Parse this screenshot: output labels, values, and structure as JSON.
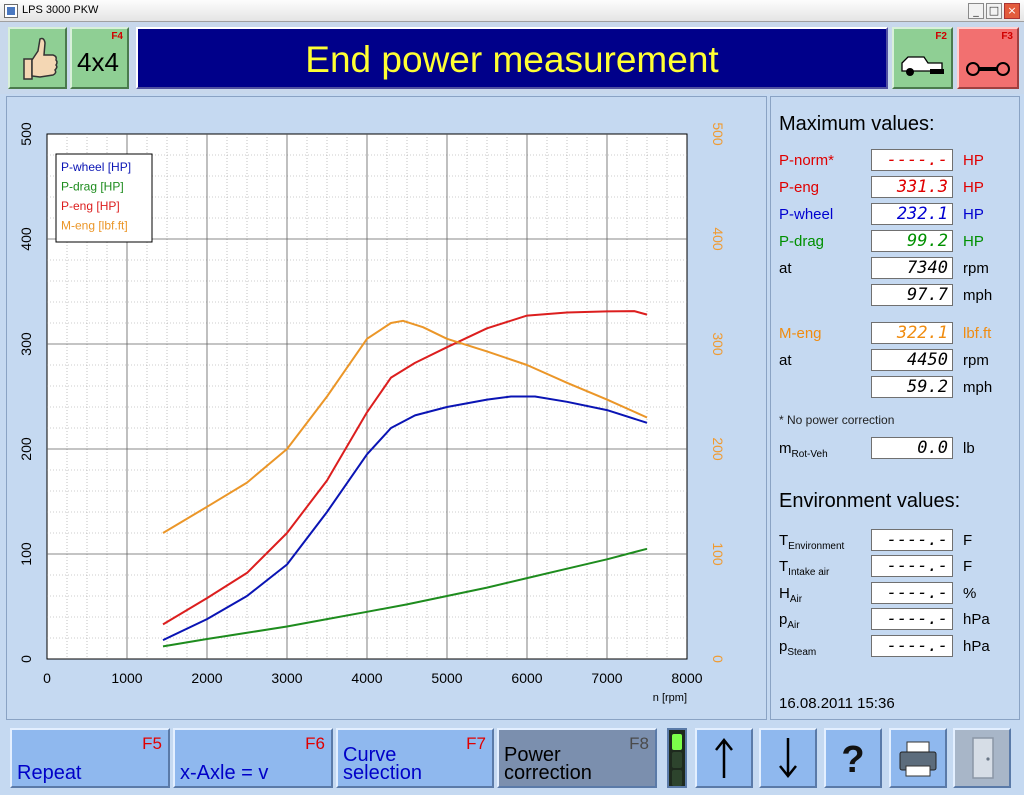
{
  "window": {
    "title": "LPS 3000 PKW",
    "min": "_",
    "max": "□",
    "close": "×"
  },
  "toolbar": {
    "ok_icon": "thumbs-up-icon",
    "fourbyfour_label": "4x4",
    "fourbyfour_fkey": "F4",
    "page_title": "End power measurement",
    "f2_fkey": "F2",
    "f2_icon": "dyno-vehicle-icon",
    "f3_fkey": "F3",
    "f3_icon": "dyno-rollers-icon"
  },
  "chart_data": {
    "type": "line",
    "xlabel": "n [rpm]",
    "xlim": [
      0,
      8000
    ],
    "ylim_left": [
      0,
      500
    ],
    "ylim_right": [
      0,
      500
    ],
    "x_ticks": [
      "0",
      "1000",
      "2000",
      "3000",
      "4000",
      "5000",
      "6000",
      "7000",
      "8000"
    ],
    "y_ticks": [
      "0",
      "100",
      "200",
      "300",
      "400",
      "500"
    ],
    "grid": true,
    "legend_position": "top-left",
    "series": [
      {
        "name": "P-wheel [HP]",
        "color": "#0a14b4",
        "x": [
          1450,
          2000,
          2500,
          3000,
          3500,
          4000,
          4300,
          4600,
          5000,
          5500,
          5800,
          6100,
          6500,
          7000,
          7500
        ],
        "y": [
          18,
          38,
          60,
          90,
          140,
          195,
          220,
          232,
          240,
          247,
          250,
          250,
          245,
          237,
          225
        ]
      },
      {
        "name": "P-drag [HP]",
        "color": "#1e8c1e",
        "x": [
          1450,
          2000,
          2500,
          3000,
          3500,
          4000,
          4500,
          5000,
          5500,
          6000,
          6500,
          7000,
          7500
        ],
        "y": [
          12,
          19,
          25,
          31,
          38,
          45,
          52,
          60,
          68,
          77,
          86,
          95,
          105
        ]
      },
      {
        "name": "P-eng [HP]",
        "color": "#dc1e1e",
        "x": [
          1450,
          2000,
          2500,
          3000,
          3500,
          4000,
          4300,
          4600,
          5000,
          5500,
          6000,
          6500,
          7000,
          7340,
          7500
        ],
        "y": [
          33,
          58,
          82,
          120,
          170,
          235,
          268,
          282,
          297,
          315,
          327,
          330,
          331,
          331.3,
          328
        ]
      },
      {
        "name": "M-eng [lbf.ft]",
        "color": "#eb9628",
        "x": [
          1450,
          2000,
          2500,
          3000,
          3500,
          4000,
          4300,
          4450,
          4700,
          5000,
          5500,
          6000,
          6500,
          7000,
          7500
        ],
        "y": [
          120,
          145,
          168,
          200,
          250,
          305,
          320,
          322.1,
          316,
          305,
          293,
          280,
          263,
          247,
          230
        ]
      }
    ]
  },
  "max_values": {
    "heading": "Maximum values:",
    "rows": [
      {
        "label": "P-norm*",
        "value": "----.-",
        "unit": "HP",
        "color": "#e00000"
      },
      {
        "label": "P-eng",
        "value": "331.3",
        "unit": "HP",
        "color": "#e00000"
      },
      {
        "label": "P-wheel",
        "value": "232.1",
        "unit": "HP",
        "color": "#0000d0"
      },
      {
        "label": "P-drag",
        "value": "99.2",
        "unit": "HP",
        "color": "#009000"
      },
      {
        "label": "at",
        "value": "7340",
        "unit": "rpm",
        "color": "#000000"
      },
      {
        "label": "",
        "value": "97.7",
        "unit": "mph",
        "color": "#000000"
      },
      {
        "label": "M-eng",
        "value": "322.1",
        "unit": "lbf.ft",
        "color": "#f08c10"
      },
      {
        "label": "at",
        "value": "4450",
        "unit": "rpm",
        "color": "#000000"
      },
      {
        "label": "",
        "value": "59.2",
        "unit": "mph",
        "color": "#000000"
      }
    ],
    "note": "* No power correction",
    "mass_label": "m",
    "mass_sub": "Rot-Veh",
    "mass_value": "0.0",
    "mass_unit": "lb"
  },
  "env_values": {
    "heading": "Environment values:",
    "rows": [
      {
        "label": "T",
        "sub": "Environment",
        "value": "----.-",
        "unit": "F"
      },
      {
        "label": "T",
        "sub": "Intake air",
        "value": "----.-",
        "unit": "F"
      },
      {
        "label": "H",
        "sub": "Air",
        "value": "----.-",
        "unit": "%"
      },
      {
        "label": "p",
        "sub": "Air",
        "value": "----.-",
        "unit": "hPa"
      },
      {
        "label": "p",
        "sub": "Steam",
        "value": "----.-",
        "unit": "hPa"
      }
    ]
  },
  "datetime": "16.08.2011   15:36",
  "bottombar": {
    "repeat": {
      "label": "Repeat",
      "fkey": "F5"
    },
    "xaxle": {
      "label": "x-Axle = v",
      "fkey": "F6"
    },
    "curve": {
      "label_1": "Curve",
      "label_2": "selection",
      "fkey": "F7"
    },
    "power": {
      "label_1": "Power",
      "label_2": "correction",
      "fkey": "F8"
    },
    "up_icon": "arrow-up-icon",
    "down_icon": "arrow-down-icon",
    "help_icon": "question-icon",
    "print_icon": "printer-icon",
    "exit_icon": "door-exit-icon",
    "status_light": "green"
  }
}
